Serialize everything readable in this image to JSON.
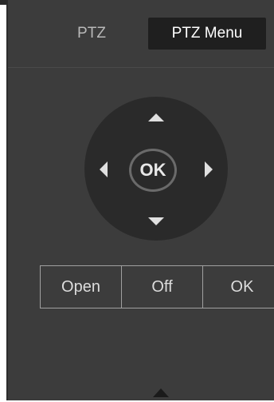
{
  "tabs": {
    "ptz_label": "PTZ",
    "menu_label": "PTZ Menu",
    "active": "PTZ Menu"
  },
  "dpad": {
    "ok_label": "OK",
    "icons": {
      "up": "arrow-up-icon",
      "down": "arrow-down-icon",
      "left": "arrow-left-icon",
      "right": "arrow-right-icon"
    }
  },
  "buttons": {
    "open_label": "Open",
    "off_label": "Off",
    "ok_label": "OK"
  },
  "collapse_icon": "triangle-up-icon",
  "colors": {
    "panel_bg": "#3c3c3c",
    "active_tab_bg": "#1f1f1f",
    "dpad_bg": "#2a2a2a",
    "text": "#dcdcdc"
  }
}
